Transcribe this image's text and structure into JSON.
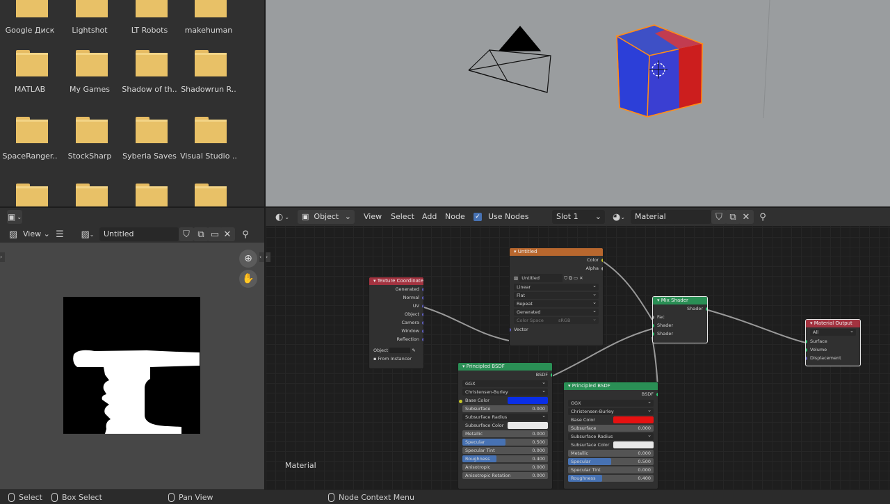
{
  "file_browser": {
    "folders": [
      {
        "label": "Google Диск"
      },
      {
        "label": "Lightshot"
      },
      {
        "label": "LT Robots"
      },
      {
        "label": "makehuman"
      },
      {
        "label": "MATLAB"
      },
      {
        "label": "My Games"
      },
      {
        "label": "Shadow of th.."
      },
      {
        "label": "Shadowrun R.."
      },
      {
        "label": "SpaceRanger.."
      },
      {
        "label": "StockSharp"
      },
      {
        "label": "Syberia Saves"
      },
      {
        "label": "Visual Studio .."
      },
      {
        "label": ""
      },
      {
        "label": ""
      },
      {
        "label": ""
      },
      {
        "label": ""
      }
    ]
  },
  "image_editor": {
    "view_label": "View",
    "image_name": "Untitled"
  },
  "node_editor": {
    "header": {
      "mode": "Object",
      "menu": [
        "View",
        "Select",
        "Add",
        "Node"
      ],
      "use_nodes_label": "Use Nodes",
      "slot": "Slot 1",
      "material": "Material"
    },
    "tree_label": "Material",
    "nodes": {
      "texture_coordinate": {
        "title": "Texture Coordinate",
        "outputs": [
          "Generated",
          "Normal",
          "UV",
          "Object",
          "Camera",
          "Window",
          "Reflection"
        ],
        "object_label": "Object",
        "from_instancer": "From Instancer"
      },
      "image_texture": {
        "title": "Untitled",
        "outputs": [
          "Color",
          "Alpha"
        ],
        "image_name": "Untitled",
        "interpolation": "Linear",
        "projection": "Flat",
        "extension": "Repeat",
        "source": "Generated",
        "color_space_label": "Color Space",
        "color_space": "sRGB",
        "input": "Vector"
      },
      "mix_shader": {
        "title": "Mix Shader",
        "output": "Shader",
        "inputs": [
          "Fac",
          "Shader",
          "Shader"
        ]
      },
      "material_output": {
        "title": "Material Output",
        "target": "All",
        "inputs": [
          "Surface",
          "Volume",
          "Displacement"
        ]
      },
      "principled_blue": {
        "title": "Principled BSDF",
        "output": "BSDF",
        "distribution": "GGX",
        "subsurface_method": "Christensen-Burley",
        "base_color_label": "Base Color",
        "base_color": "#0a2ee6",
        "subsurface": {
          "label": "Subsurface",
          "value": "0.000"
        },
        "subsurface_radius": "Subsurface Radius",
        "subsurface_color_label": "Subsurface Color",
        "fields": [
          {
            "label": "Metallic",
            "value": "0.000",
            "fill": 0
          },
          {
            "label": "Specular",
            "value": "0.500",
            "fill": 0.5
          },
          {
            "label": "Specular Tint",
            "value": "0.000",
            "fill": 0
          },
          {
            "label": "Roughness",
            "value": "0.400",
            "fill": 0.4
          },
          {
            "label": "Anisotropic",
            "value": "0.000",
            "fill": 0
          },
          {
            "label": "Anisotropic Rotation",
            "value": "0.000",
            "fill": 0
          }
        ]
      },
      "principled_red": {
        "title": "Principled BSDF",
        "output": "BSDF",
        "distribution": "GGX",
        "subsurface_method": "Christensen-Burley",
        "base_color_label": "Base Color",
        "base_color": "#e61111",
        "subsurface": {
          "label": "Subsurface",
          "value": "0.000"
        },
        "subsurface_radius": "Subsurface Radius",
        "subsurface_color_label": "Subsurface Color",
        "fields": [
          {
            "label": "Metallic",
            "value": "0.000",
            "fill": 0
          },
          {
            "label": "Specular",
            "value": "0.500",
            "fill": 0.5
          },
          {
            "label": "Specular Tint",
            "value": "0.000",
            "fill": 0
          },
          {
            "label": "Roughness",
            "value": "0.400",
            "fill": 0.4
          }
        ]
      }
    }
  },
  "status_bar": {
    "select": "Select",
    "box_select": "Box Select",
    "pan_view": "Pan View",
    "context_menu": "Node Context Menu"
  },
  "colors": {
    "header_texture_coordinate": "#a33340",
    "header_image_texture": "#b8672e",
    "header_shader": "#2a8f55",
    "header_output": "#a33340",
    "cube_blue": "#2c3fd8",
    "cube_red": "#cc1e1e",
    "selection_outline": "#ff8c1a"
  }
}
